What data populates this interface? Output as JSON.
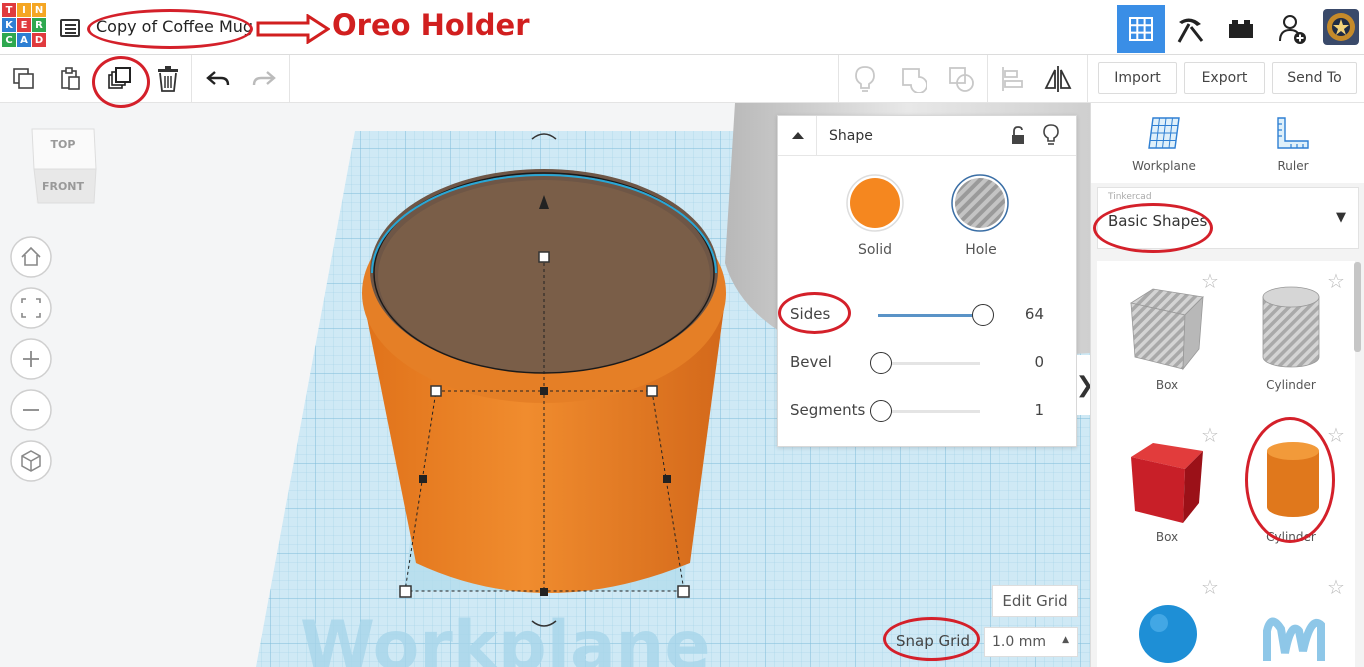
{
  "app": {
    "logo_letters": [
      "T",
      "I",
      "N",
      "K",
      "E",
      "R",
      "C",
      "A",
      "D"
    ],
    "logo_colors": [
      "#e03a3e",
      "#f5a623",
      "#f5a623",
      "#2e7fd3",
      "#e03a3e",
      "#2ea84f",
      "#2ea84f",
      "#2e7fd3",
      "#e03a3e"
    ]
  },
  "header": {
    "design_title": "Copy of Coffee Mug",
    "annotation_text": "Oreo Holder",
    "icons": [
      "grid-view-icon",
      "pickaxe-icon",
      "bricks-icon",
      "add-user-icon"
    ],
    "accent_color": "#3a8ee6"
  },
  "toolbar": {
    "import_label": "Import",
    "export_label": "Export",
    "send_to_label": "Send To"
  },
  "viewcube": {
    "top_label": "TOP",
    "front_label": "FRONT"
  },
  "inspector": {
    "title": "Shape",
    "solid_label": "Solid",
    "hole_label": "Hole",
    "solid_color": "#f5871f",
    "props": [
      {
        "label": "Sides",
        "value": "64",
        "fraction": 1.0
      },
      {
        "label": "Bevel",
        "value": "0",
        "fraction": 0.0
      },
      {
        "label": "Segments",
        "value": "1",
        "fraction": 0.0
      }
    ]
  },
  "rightpanel": {
    "workplane_label": "Workplane",
    "ruler_label": "Ruler",
    "library_caption": "Tinkercad",
    "library_value": "Basic Shapes",
    "shapes": [
      {
        "label": "Box",
        "kind": "hole-box"
      },
      {
        "label": "Cylinder",
        "kind": "hole-cylinder"
      },
      {
        "label": "Box",
        "kind": "solid-box"
      },
      {
        "label": "Cylinder",
        "kind": "solid-cylinder"
      }
    ]
  },
  "viewport": {
    "edit_grid_label": "Edit Grid",
    "snap_grid_label": "Snap Grid",
    "snap_grid_value": "1.0 mm",
    "workplane_watermark": "Workplane"
  }
}
